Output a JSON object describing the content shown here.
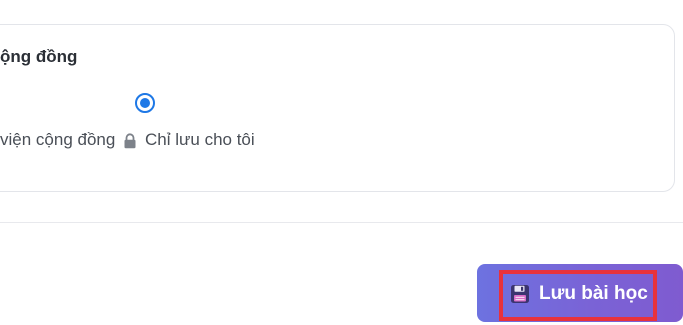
{
  "section": {
    "title": "ộng đồng"
  },
  "visibility": {
    "public_label": "viện cộng đồng",
    "private_label": "Chỉ lưu cho tôi",
    "selected": "private"
  },
  "footer": {
    "save_label": "Lưu bài học",
    "save_icon": "floppy-disk-icon"
  },
  "colors": {
    "accent": "#1e78e6",
    "button_gradient_start": "#6d72e0",
    "button_gradient_end": "#7f5bd0",
    "highlight": "#e8323c"
  }
}
